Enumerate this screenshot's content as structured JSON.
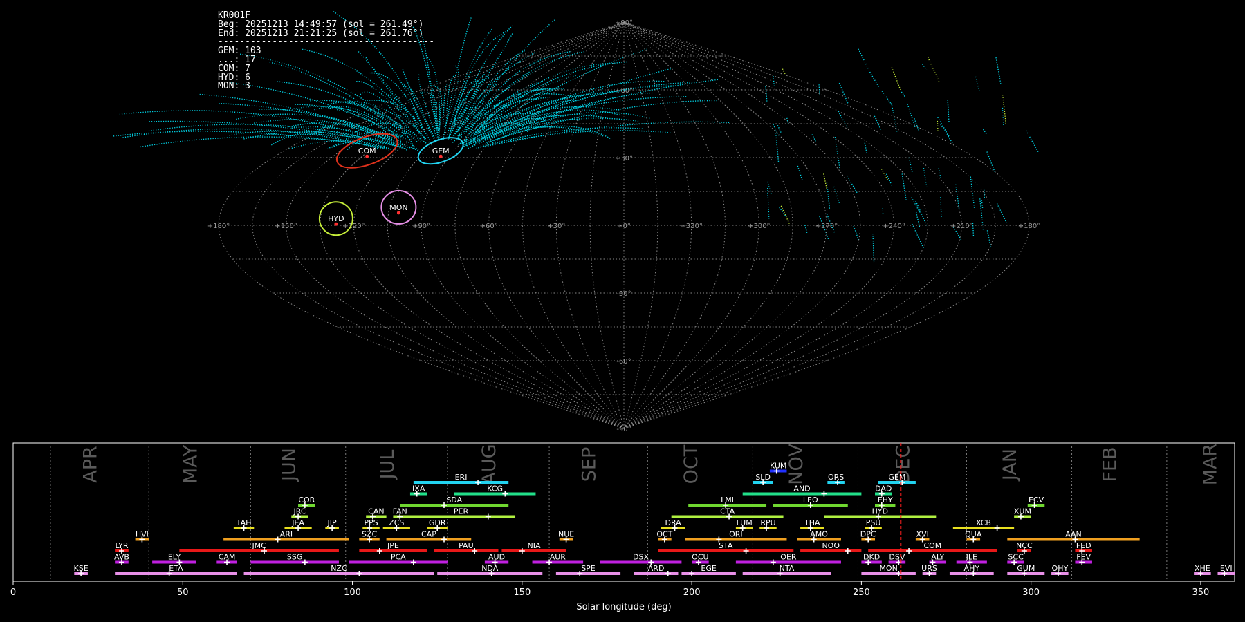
{
  "info": {
    "lines": [
      "KR001F",
      "Beg: 20251213 14:49:57 (sol = 261.49°)",
      "End: 20251213 21:21:25 (sol = 261.76°)",
      "----------------------------------------",
      "GEM: 103",
      "...: 17",
      "COM: 7",
      "HYD: 6",
      "MON: 3"
    ]
  },
  "colors": {
    "background": "#000000",
    "sporadic": "#00d5e8",
    "GEM": "#22d3f0",
    "COM": "#e0321c",
    "HYD": "#c8f03a",
    "MON": "#e890e8",
    "current_sol": "#ff2020"
  },
  "chart_data": [
    {
      "type": "scatter",
      "title": "",
      "projection": "sinusoidal",
      "lat_ticks": [
        "+90°",
        "+60°",
        "+30°",
        "+0°",
        "-30°",
        "-60°",
        "-90°"
      ],
      "lon_ticks": [
        "+180°",
        "+150°",
        "+120°",
        "+90°",
        "+60°",
        "+30°",
        "+0°",
        "+330°",
        "+300°",
        "+270°",
        "+240°",
        "+210°",
        "+180°"
      ],
      "radiants": [
        {
          "name": "GEM",
          "lon": 97,
          "lat": 33
        },
        {
          "name": "COM",
          "lon": 136,
          "lat": 33
        },
        {
          "name": "HYD",
          "lon": 128,
          "lat": 3
        },
        {
          "name": "MON",
          "lon": 101,
          "lat": 8
        }
      ]
    },
    {
      "type": "bar",
      "title": "",
      "xlabel": "Solar longitude (deg)",
      "ylabel": "",
      "xlim": [
        0,
        360
      ],
      "x_ticks": [
        0,
        50,
        100,
        150,
        200,
        250,
        300,
        350
      ],
      "current_sol": 261.6,
      "months": [
        {
          "label": "APR",
          "start": 11,
          "end": 40
        },
        {
          "label": "MAY",
          "start": 40,
          "end": 70
        },
        {
          "label": "JUN",
          "start": 70,
          "end": 98
        },
        {
          "label": "JUL",
          "start": 98,
          "end": 128
        },
        {
          "label": "AUG",
          "start": 128,
          "end": 158
        },
        {
          "label": "SEP",
          "start": 158,
          "end": 187
        },
        {
          "label": "OCT",
          "start": 187,
          "end": 218
        },
        {
          "label": "NOV",
          "start": 218,
          "end": 249
        },
        {
          "label": "DEC",
          "start": 249,
          "end": 281
        },
        {
          "label": "JAN",
          "start": 281,
          "end": 312
        },
        {
          "label": "FEB",
          "start": 312,
          "end": 340
        },
        {
          "label": "MAR",
          "start": 340,
          "end": 371
        }
      ],
      "showers": [
        {
          "code": "KUM",
          "row": 9,
          "start": 223,
          "end": 228,
          "peak": 225,
          "color": "#2030ff"
        },
        {
          "code": "ERI",
          "row": 8,
          "start": 118,
          "end": 146,
          "peak": 137,
          "color": "#22d3f0"
        },
        {
          "code": "SLD",
          "row": 8,
          "start": 218,
          "end": 224,
          "peak": 221,
          "color": "#22d3f0"
        },
        {
          "code": "ORS",
          "row": 8,
          "start": 240,
          "end": 245,
          "peak": 243,
          "color": "#22d3f0"
        },
        {
          "code": "GEM",
          "row": 8,
          "start": 255,
          "end": 266,
          "peak": 262,
          "color": "#22d3f0"
        },
        {
          "code": "IXA",
          "row": 7,
          "start": 117,
          "end": 122,
          "peak": 119,
          "color": "#22e08a"
        },
        {
          "code": "KCG",
          "row": 7,
          "start": 130,
          "end": 154,
          "peak": 145,
          "color": "#22e08a"
        },
        {
          "code": "AND",
          "row": 7,
          "start": 215,
          "end": 250,
          "peak": 239,
          "color": "#22e08a"
        },
        {
          "code": "DAD",
          "row": 7,
          "start": 254,
          "end": 259,
          "peak": 256,
          "color": "#22e08a"
        },
        {
          "code": "COR",
          "row": 6,
          "start": 84,
          "end": 89,
          "peak": 86,
          "color": "#70d830"
        },
        {
          "code": "SDA",
          "row": 6,
          "start": 114,
          "end": 146,
          "peak": 127,
          "color": "#70d830"
        },
        {
          "code": "LMI",
          "row": 6,
          "start": 199,
          "end": 222,
          "peak": 210,
          "color": "#70d830"
        },
        {
          "code": "LEO",
          "row": 6,
          "start": 224,
          "end": 246,
          "peak": 235,
          "color": "#70d830"
        },
        {
          "code": "EHY",
          "row": 6,
          "start": 254,
          "end": 260,
          "peak": 256,
          "color": "#70d830"
        },
        {
          "code": "ECV",
          "row": 6,
          "start": 299,
          "end": 304,
          "peak": 301,
          "color": "#70d830"
        },
        {
          "code": "JRC",
          "row": 5,
          "start": 82,
          "end": 87,
          "peak": 84,
          "color": "#b0f040"
        },
        {
          "code": "CAN",
          "row": 5,
          "start": 104,
          "end": 110,
          "peak": 106,
          "color": "#b0f040"
        },
        {
          "code": "FAN",
          "row": 5,
          "start": 112,
          "end": 116,
          "peak": 114,
          "color": "#b0f040"
        },
        {
          "code": "PER",
          "row": 5,
          "start": 116,
          "end": 148,
          "peak": 140,
          "color": "#b0f040"
        },
        {
          "code": "CTA",
          "row": 5,
          "start": 194,
          "end": 227,
          "peak": 211,
          "color": "#b0f040"
        },
        {
          "code": "HYD",
          "row": 5,
          "start": 239,
          "end": 272,
          "peak": 255,
          "color": "#b0f040"
        },
        {
          "code": "XUM",
          "row": 5,
          "start": 295,
          "end": 300,
          "peak": 297,
          "color": "#b0f040"
        },
        {
          "code": "TAH",
          "row": 4,
          "start": 65,
          "end": 71,
          "peak": 68,
          "color": "#e8e020"
        },
        {
          "code": "JEA",
          "row": 4,
          "start": 80,
          "end": 88,
          "peak": 84,
          "color": "#e8e020"
        },
        {
          "code": "JIP",
          "row": 4,
          "start": 92,
          "end": 96,
          "peak": 94,
          "color": "#e8e020"
        },
        {
          "code": "PPS",
          "row": 4,
          "start": 103,
          "end": 108,
          "peak": 105,
          "color": "#e8e020"
        },
        {
          "code": "ZCS",
          "row": 4,
          "start": 109,
          "end": 117,
          "peak": 113,
          "color": "#e8e020"
        },
        {
          "code": "GDR",
          "row": 4,
          "start": 122,
          "end": 128,
          "peak": 125,
          "color": "#e8e020"
        },
        {
          "code": "DRA",
          "row": 4,
          "start": 191,
          "end": 198,
          "peak": 195,
          "color": "#e8e020"
        },
        {
          "code": "LUM",
          "row": 4,
          "start": 213,
          "end": 218,
          "peak": 215,
          "color": "#e8e020"
        },
        {
          "code": "RPU",
          "row": 4,
          "start": 220,
          "end": 225,
          "peak": 222,
          "color": "#e8e020"
        },
        {
          "code": "THA",
          "row": 4,
          "start": 232,
          "end": 239,
          "peak": 235,
          "color": "#e8e020"
        },
        {
          "code": "PSU",
          "row": 4,
          "start": 251,
          "end": 256,
          "peak": 253,
          "color": "#e8e020"
        },
        {
          "code": "XCB",
          "row": 4,
          "start": 277,
          "end": 295,
          "peak": 290,
          "color": "#e8e020"
        },
        {
          "code": "HVI",
          "row": 3,
          "start": 36,
          "end": 40,
          "peak": 38,
          "color": "#f0a020"
        },
        {
          "code": "ARI",
          "row": 3,
          "start": 62,
          "end": 99,
          "peak": 78,
          "color": "#f0a020"
        },
        {
          "code": "SZC",
          "row": 3,
          "start": 102,
          "end": 108,
          "peak": 105,
          "color": "#f0a020"
        },
        {
          "code": "CAP",
          "row": 3,
          "start": 110,
          "end": 135,
          "peak": 127,
          "color": "#f0a020"
        },
        {
          "code": "NUE",
          "row": 3,
          "start": 161,
          "end": 165,
          "peak": 163,
          "color": "#f0a020"
        },
        {
          "code": "OCT",
          "row": 3,
          "start": 190,
          "end": 194,
          "peak": 192,
          "color": "#f0a020"
        },
        {
          "code": "ORI",
          "row": 3,
          "start": 198,
          "end": 228,
          "peak": 208,
          "color": "#f0a020"
        },
        {
          "code": "AMO",
          "row": 3,
          "start": 231,
          "end": 244,
          "peak": 236,
          "color": "#f0a020"
        },
        {
          "code": "DPC",
          "row": 3,
          "start": 250,
          "end": 254,
          "peak": 252,
          "color": "#f0a020"
        },
        {
          "code": "XVI",
          "row": 3,
          "start": 266,
          "end": 270,
          "peak": 268,
          "color": "#f0a020"
        },
        {
          "code": "QUA",
          "row": 3,
          "start": 281,
          "end": 285,
          "peak": 283,
          "color": "#f0a020"
        },
        {
          "code": "AAN",
          "row": 3,
          "start": 293,
          "end": 332,
          "peak": 313,
          "color": "#f0a020"
        },
        {
          "code": "LYR",
          "row": 2,
          "start": 30,
          "end": 34,
          "peak": 32,
          "color": "#e81818"
        },
        {
          "code": "JMC",
          "row": 2,
          "start": 49,
          "end": 96,
          "peak": 74,
          "color": "#e81818"
        },
        {
          "code": "JPE",
          "row": 2,
          "start": 102,
          "end": 122,
          "peak": 108,
          "color": "#e81818"
        },
        {
          "code": "PAU",
          "row": 2,
          "start": 124,
          "end": 143,
          "peak": 136,
          "color": "#e81818"
        },
        {
          "code": "NIA",
          "row": 2,
          "start": 144,
          "end": 163,
          "peak": 150,
          "color": "#e81818"
        },
        {
          "code": "STA",
          "row": 2,
          "start": 190,
          "end": 230,
          "peak": 216,
          "color": "#e81818"
        },
        {
          "code": "NOO",
          "row": 2,
          "start": 232,
          "end": 250,
          "peak": 246,
          "color": "#e81818"
        },
        {
          "code": "COM",
          "row": 2,
          "start": 252,
          "end": 290,
          "peak": 264,
          "color": "#e81818"
        },
        {
          "code": "NCC",
          "row": 2,
          "start": 296,
          "end": 300,
          "peak": 298,
          "color": "#e81818"
        },
        {
          "code": "FED",
          "row": 2,
          "start": 313,
          "end": 318,
          "peak": 315,
          "color": "#e81818"
        },
        {
          "code": "AVB",
          "row": 1,
          "start": 30,
          "end": 34,
          "peak": 32,
          "color": "#c020e0"
        },
        {
          "code": "ELY",
          "row": 1,
          "start": 41,
          "end": 54,
          "peak": 49,
          "color": "#c020e0"
        },
        {
          "code": "CAM",
          "row": 1,
          "start": 60,
          "end": 66,
          "peak": 63,
          "color": "#c020e0"
        },
        {
          "code": "SSG",
          "row": 1,
          "start": 70,
          "end": 96,
          "peak": 86,
          "color": "#c020e0"
        },
        {
          "code": "PCA",
          "row": 1,
          "start": 99,
          "end": 128,
          "peak": 118,
          "color": "#c020e0"
        },
        {
          "code": "AUD",
          "row": 1,
          "start": 139,
          "end": 146,
          "peak": 142,
          "color": "#c020e0"
        },
        {
          "code": "AUR",
          "row": 1,
          "start": 153,
          "end": 168,
          "peak": 158,
          "color": "#c020e0"
        },
        {
          "code": "DSX",
          "row": 1,
          "start": 173,
          "end": 197,
          "peak": 188,
          "color": "#c020e0"
        },
        {
          "code": "OCU",
          "row": 1,
          "start": 200,
          "end": 205,
          "peak": 202,
          "color": "#c020e0"
        },
        {
          "code": "OER",
          "row": 1,
          "start": 213,
          "end": 244,
          "peak": 224,
          "color": "#c020e0"
        },
        {
          "code": "DKD",
          "row": 1,
          "start": 250,
          "end": 256,
          "peak": 252,
          "color": "#c020e0"
        },
        {
          "code": "DSV",
          "row": 1,
          "start": 258,
          "end": 263,
          "peak": 261,
          "color": "#c020e0"
        },
        {
          "code": "ALY",
          "row": 1,
          "start": 270,
          "end": 275,
          "peak": 271,
          "color": "#c020e0"
        },
        {
          "code": "JLE",
          "row": 1,
          "start": 278,
          "end": 287,
          "peak": 282,
          "color": "#c020e0"
        },
        {
          "code": "SCC",
          "row": 1,
          "start": 293,
          "end": 298,
          "peak": 295,
          "color": "#c020e0"
        },
        {
          "code": "FEV",
          "row": 1,
          "start": 313,
          "end": 318,
          "peak": 315,
          "color": "#c020e0"
        },
        {
          "code": "KSE",
          "row": 0,
          "start": 18,
          "end": 22,
          "peak": 20,
          "color": "#e890e8"
        },
        {
          "code": "ETA",
          "row": 0,
          "start": 30,
          "end": 66,
          "peak": 46,
          "color": "#e890e8"
        },
        {
          "code": "NZC",
          "row": 0,
          "start": 68,
          "end": 124,
          "peak": 102,
          "color": "#e890e8"
        },
        {
          "code": "NDA",
          "row": 0,
          "start": 125,
          "end": 156,
          "peak": 141,
          "color": "#e890e8"
        },
        {
          "code": "SPE",
          "row": 0,
          "start": 160,
          "end": 179,
          "peak": 167,
          "color": "#e890e8"
        },
        {
          "code": "ARD",
          "row": 0,
          "start": 183,
          "end": 196,
          "peak": 193,
          "color": "#e890e8"
        },
        {
          "code": "EGE",
          "row": 0,
          "start": 197,
          "end": 213,
          "peak": 200,
          "color": "#e890e8"
        },
        {
          "code": "NTA",
          "row": 0,
          "start": 215,
          "end": 241,
          "peak": 226,
          "color": "#e890e8"
        },
        {
          "code": "MON",
          "row": 0,
          "start": 250,
          "end": 266,
          "peak": 261,
          "color": "#e890e8"
        },
        {
          "code": "URS",
          "row": 0,
          "start": 268,
          "end": 272,
          "peak": 270,
          "color": "#e890e8"
        },
        {
          "code": "AHY",
          "row": 0,
          "start": 276,
          "end": 289,
          "peak": 283,
          "color": "#e890e8"
        },
        {
          "code": "GUM",
          "row": 0,
          "start": 293,
          "end": 304,
          "peak": 298,
          "color": "#e890e8"
        },
        {
          "code": "OHY",
          "row": 0,
          "start": 306,
          "end": 311,
          "peak": 308,
          "color": "#e890e8"
        },
        {
          "code": "XHE",
          "row": 0,
          "start": 348,
          "end": 353,
          "peak": 350,
          "color": "#e890e8"
        },
        {
          "code": "EVI",
          "row": 0,
          "start": 355,
          "end": 360,
          "peak": 357,
          "color": "#e890e8"
        }
      ]
    }
  ]
}
